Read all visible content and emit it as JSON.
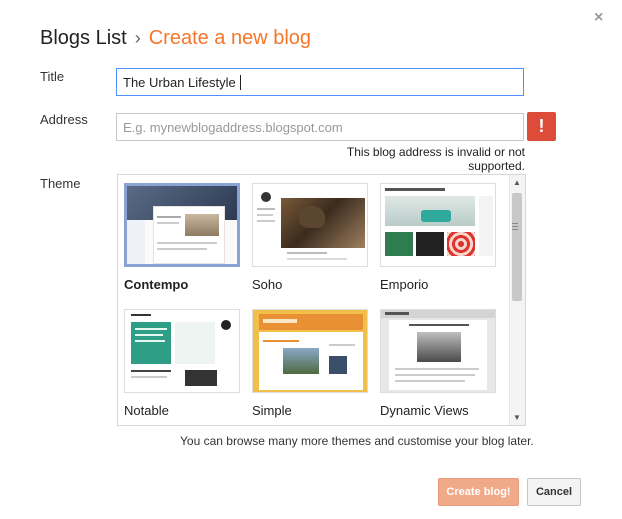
{
  "dialog": {
    "close_glyph": "×",
    "breadcrumb": {
      "parent": "Blogs List",
      "separator": "›",
      "current": "Create a new blog"
    }
  },
  "form": {
    "title_label": "Title",
    "title_value": "The Urban Lifestyle",
    "address_label": "Address",
    "address_placeholder": "E.g. mynewblogaddress.blogspot.com",
    "address_error": "This blog address is invalid or not supported.",
    "error_glyph": "!",
    "theme_label": "Theme"
  },
  "themes": [
    {
      "name": "Contempo",
      "selected": true,
      "icon": "contempo-thumbnail"
    },
    {
      "name": "Soho",
      "selected": false,
      "icon": "soho-thumbnail"
    },
    {
      "name": "Emporio",
      "selected": false,
      "icon": "emporio-thumbnail"
    },
    {
      "name": "Notable",
      "selected": false,
      "icon": "notable-thumbnail"
    },
    {
      "name": "Simple",
      "selected": false,
      "icon": "simple-thumbnail"
    },
    {
      "name": "Dynamic Views",
      "selected": false,
      "icon": "dynamic-views-thumbnail"
    }
  ],
  "browse_note": "You can browse many more themes and customise your blog later.",
  "buttons": {
    "create": "Create blog!",
    "cancel": "Cancel"
  },
  "colors": {
    "accent": "#f4762a",
    "error": "#dd4b39",
    "focus": "#4d90fe",
    "create_button": "#f0a989"
  }
}
